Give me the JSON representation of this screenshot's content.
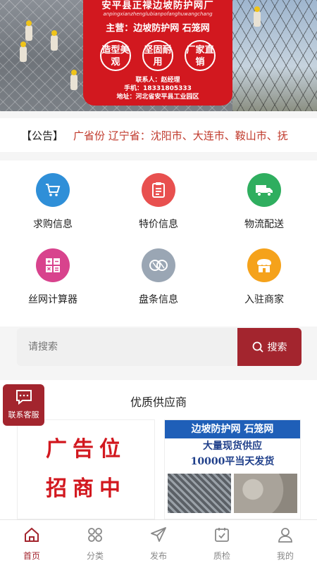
{
  "banner": {
    "factory_name": "安平县正禄边坡防护网厂",
    "factory_pinyin": "anpingxianzhenglubianpofanghuwangchang",
    "main_products": "主营：边坡防护网  石笼网",
    "badges": [
      "造型美观",
      "坚固耐用",
      "厂家直销"
    ],
    "contact_person": "联系人：赵经理",
    "phone": "手机：18331805333",
    "address": "地址：河北省安平县工业园区"
  },
  "notice": {
    "label": "【公告】",
    "text": "广省份 辽宁省：沈阳市、大连市、鞍山市、抚"
  },
  "categories": [
    {
      "label": "求购信息",
      "icon": "cart-icon",
      "color": "#2f8fd8"
    },
    {
      "label": "特价信息",
      "icon": "clipboard-icon",
      "color": "#e8504f"
    },
    {
      "label": "物流配送",
      "icon": "truck-icon",
      "color": "#2fae5f"
    },
    {
      "label": "丝网计算器",
      "icon": "calculator-icon",
      "color": "#d8438d"
    },
    {
      "label": "盘条信息",
      "icon": "coil-icon",
      "color": "#9aa6b4"
    },
    {
      "label": "入驻商家",
      "icon": "store-icon",
      "color": "#f5a21b"
    }
  ],
  "search": {
    "placeholder": "请搜索",
    "button_label": "搜索"
  },
  "suppliers": {
    "title": "优质供应商",
    "ad_slot_text": [
      "广告位",
      "招商中"
    ],
    "ad2_header": "边坡防护网 石笼网",
    "ad2_lines": [
      "大量现货供应",
      "10000平当天发货"
    ]
  },
  "customer_service": {
    "label": "联系客服"
  },
  "tabbar": [
    {
      "label": "首页",
      "icon": "home-icon",
      "active": true
    },
    {
      "label": "分类",
      "icon": "grid-icon",
      "active": false
    },
    {
      "label": "发布",
      "icon": "send-icon",
      "active": false
    },
    {
      "label": "质检",
      "icon": "check-doc-icon",
      "active": false
    },
    {
      "label": "我的",
      "icon": "user-icon",
      "active": false
    }
  ],
  "colors": {
    "brand": "#a3252e",
    "notice_text": "#c0392b",
    "banner_red": "#d2181f"
  }
}
